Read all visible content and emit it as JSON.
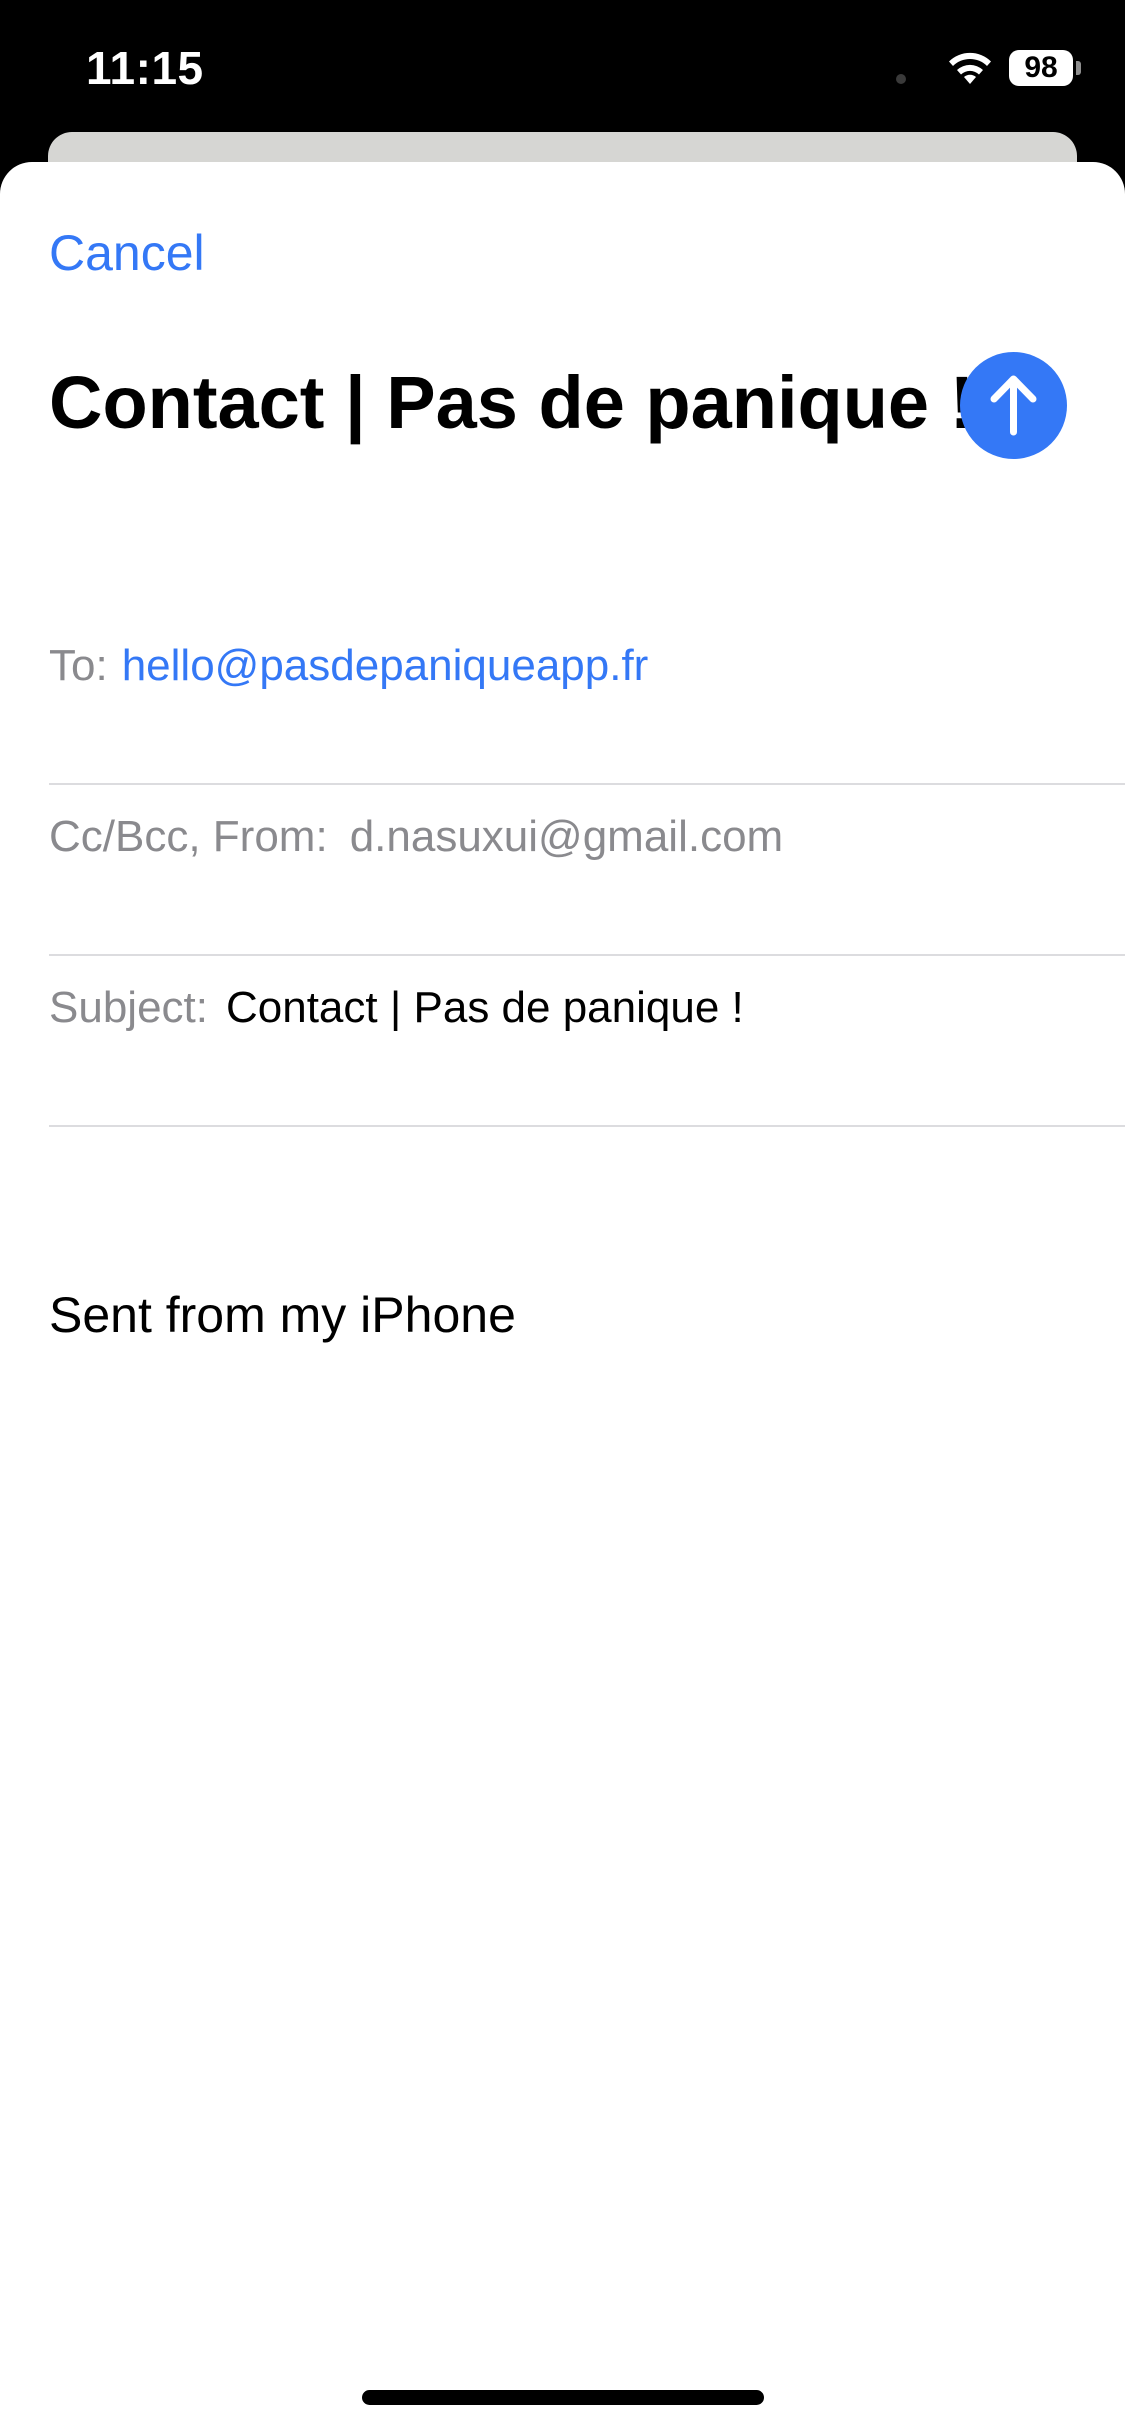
{
  "status_bar": {
    "time": "11:15",
    "battery_level": "98",
    "wifi_icon": "wifi-icon"
  },
  "compose": {
    "cancel_label": "Cancel",
    "title": "Contact | Pas de panique !",
    "send_icon": "arrow-up-icon",
    "to_label": "To:",
    "to_value": "hello@pasdepaniqueapp.fr",
    "ccbcc_label": "Cc/Bcc, From:",
    "from_value": "d.nasuxui@gmail.com",
    "subject_label": "Subject:",
    "subject_value": "Contact | Pas de panique !",
    "body_signature": "Sent from my iPhone"
  },
  "colors": {
    "accent": "#3478f6",
    "label_grey": "#8a8a8e",
    "separator": "#dcdcdf"
  }
}
